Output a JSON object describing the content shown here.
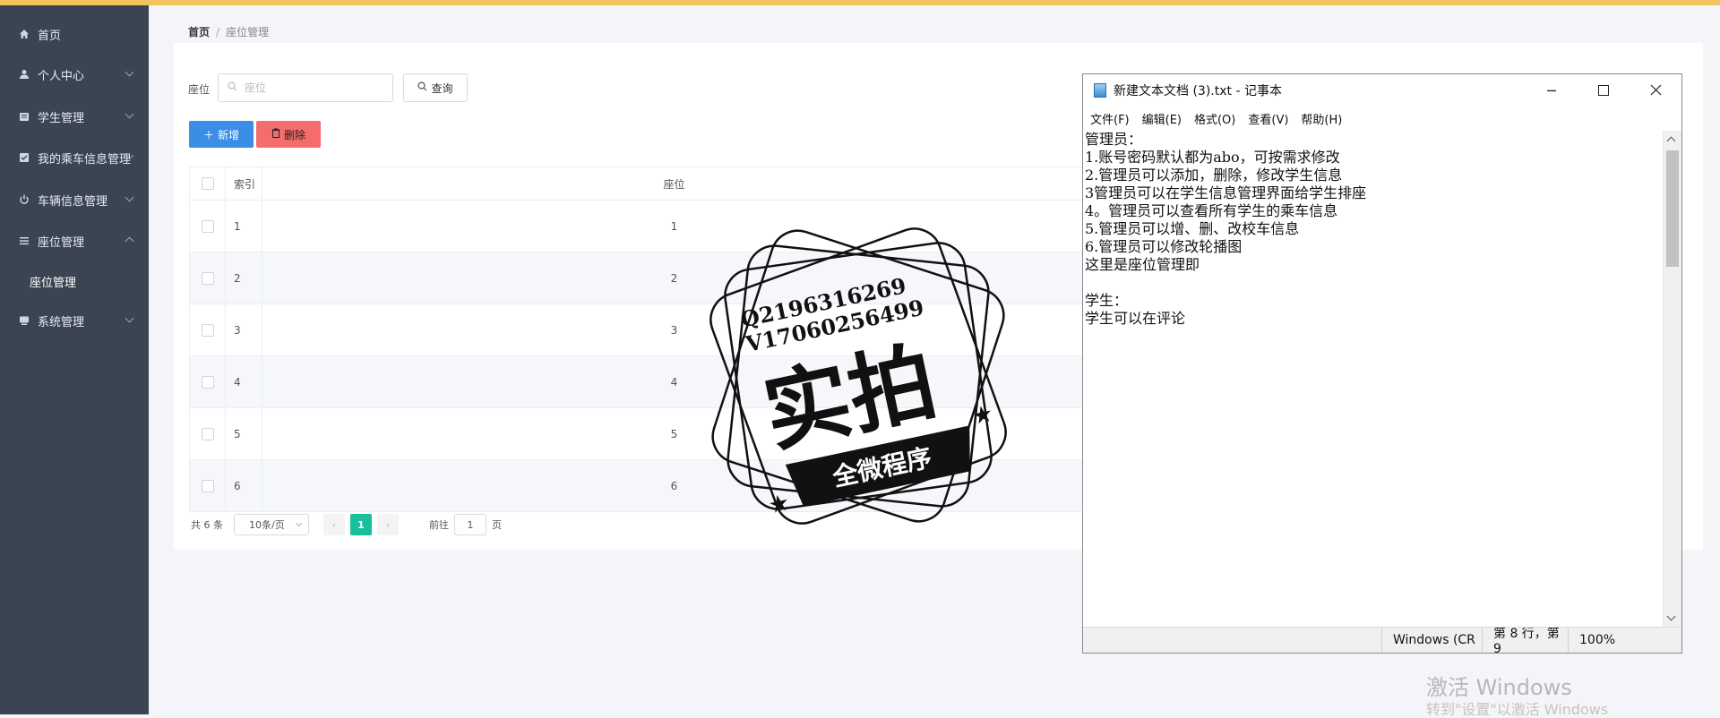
{
  "sidebar": {
    "items": [
      {
        "label": "首页",
        "icon": "home-icon"
      },
      {
        "label": "个人中心",
        "icon": "user-icon"
      },
      {
        "label": "学生管理",
        "icon": "student-icon"
      },
      {
        "label": "我的乘车信息管理",
        "icon": "ride-icon"
      },
      {
        "label": "车辆信息管理",
        "icon": "power-icon"
      },
      {
        "label": "座位管理",
        "icon": "list-icon"
      },
      {
        "label": "系统管理",
        "icon": "system-icon"
      }
    ],
    "sub_item": "座位管理"
  },
  "breadcrumb": {
    "home": "首页",
    "separator": "/",
    "current": "座位管理"
  },
  "search": {
    "label": "座位",
    "placeholder": "座位",
    "query_button": "查询"
  },
  "actions": {
    "add": "新增",
    "delete": "删除"
  },
  "table": {
    "headers": {
      "index": "索引",
      "seat": "座位"
    },
    "rows": [
      {
        "index": "1",
        "seat": "1"
      },
      {
        "index": "2",
        "seat": "2"
      },
      {
        "index": "3",
        "seat": "3"
      },
      {
        "index": "4",
        "seat": "4"
      },
      {
        "index": "5",
        "seat": "5"
      },
      {
        "index": "6",
        "seat": "6"
      }
    ]
  },
  "pagination": {
    "total": "共 6 条",
    "page_size": "10条/页",
    "current_page": "1",
    "goto_label": "前往",
    "goto_value": "1",
    "goto_suffix": "页"
  },
  "stamp": {
    "line1": "Q2196316269",
    "line2": "V17060256499",
    "main": "实拍",
    "banner": "全微程序"
  },
  "notepad": {
    "title": "新建文本文档 (3).txt - 记事本",
    "menu": [
      "文件(F)",
      "编辑(E)",
      "格式(O)",
      "查看(V)",
      "帮助(H)"
    ],
    "content": "管理员：\n1.账号密码默认都为abo，可按需求修改\n2.管理员可以添加，删除，修改学生信息\n3管理员可以在学生信息管理界面给学生排座\n4。管理员可以查看所有学生的乘车信息\n5.管理员可以增、删、改校车信息\n6.管理员可以修改轮播图\n这里是座位管理即\n\n学生：\n学生可以在评论",
    "status": {
      "encoding": "Windows (CR",
      "position": "第 8 行，第 9",
      "zoom": "100%"
    }
  },
  "watermark": {
    "line1": "激活 Windows",
    "line2": "转到\"设置\"以激活 Windows"
  }
}
